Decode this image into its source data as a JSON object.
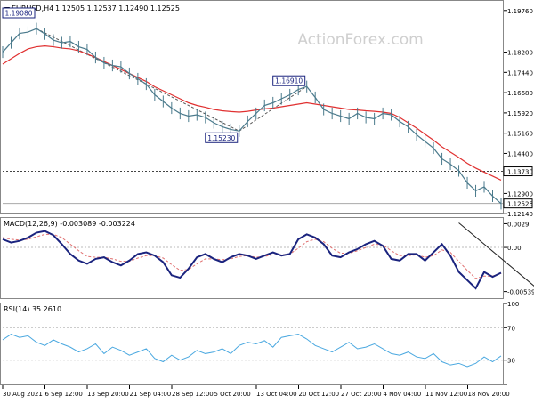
{
  "chart": {
    "header_symbol": "EURUSD,H4",
    "header_prices": "1.12505 1.12537 1.12490 1.12525",
    "watermark": "ActionForex.com",
    "colors": {
      "price": "#4a7a8c",
      "ma": "#e03030",
      "macd": "#1a237e",
      "signal": "#e07070",
      "rsi": "#4aa8e0",
      "label_border": "#1a237e",
      "label_text": "#1a237e",
      "grid": "#bbbbbb"
    }
  },
  "chart_data": [
    {
      "type": "line",
      "title": "EURUSD,H4",
      "ylim": [
        1.1218,
        1.2012
      ],
      "y_ticks": [
        "1.19760",
        "1.18200",
        "1.17440",
        "1.16680",
        "1.15920",
        "1.15160",
        "1.14400",
        "1.13730",
        "1.12900",
        "1.12525",
        "1.12140"
      ],
      "series": [
        {
          "values": [
            1.182,
            1.1855,
            1.189,
            1.1895,
            1.1908,
            1.1888,
            1.1865,
            1.1855,
            1.186,
            1.184,
            1.183,
            1.18,
            1.178,
            1.177,
            1.1765,
            1.174,
            1.172,
            1.17,
            1.166,
            1.1635,
            1.161,
            1.159,
            1.158,
            1.1585,
            1.1575,
            1.1555,
            1.154,
            1.153,
            1.1524,
            1.156,
            1.159,
            1.162,
            1.163,
            1.1645,
            1.166,
            1.168,
            1.1691,
            1.165,
            1.1605,
            1.159,
            1.158,
            1.157,
            1.159,
            1.1575,
            1.157,
            1.159,
            1.1585,
            1.156,
            1.154,
            1.151,
            1.1485,
            1.146,
            1.142,
            1.14,
            1.1375,
            1.133,
            1.13,
            1.1315,
            1.128,
            1.1252
          ]
        },
        {
          "name": "",
          "values": [
            1.1775,
            1.1795,
            1.1815,
            1.1832,
            1.184,
            1.1843,
            1.184,
            1.1835,
            1.1832,
            1.1825,
            1.1813,
            1.18,
            1.1785,
            1.177,
            1.1755,
            1.174,
            1.1725,
            1.171,
            1.169,
            1.1675,
            1.166,
            1.1645,
            1.163,
            1.162,
            1.1613,
            1.1605,
            1.16,
            1.1597,
            1.1595,
            1.1598,
            1.1603,
            1.1607,
            1.161,
            1.1615,
            1.162,
            1.1625,
            1.163,
            1.1625,
            1.162,
            1.1615,
            1.161,
            1.1605,
            1.1603,
            1.16,
            1.1598,
            1.1595,
            1.159,
            1.1575,
            1.1555,
            1.1535,
            1.1512,
            1.149,
            1.1465,
            1.1445,
            1.1425,
            1.1403,
            1.1385,
            1.137,
            1.1355,
            1.134
          ]
        }
      ],
      "annotations": [
        "1.19080",
        "1.15230",
        "1.16910",
        "1.13730",
        "1.12525"
      ],
      "reference_lines": [
        1.1373,
        1.12525
      ]
    },
    {
      "type": "line",
      "title": "MACD(12,26,9) -0.003089 -0.003224",
      "ylim": [
        -0.0062,
        0.0036
      ],
      "y_ticks": [
        "0.0029",
        "0.00",
        "-0.005396"
      ],
      "series": [
        {
          "values": [
            0.001,
            0.0006,
            0.0008,
            0.0012,
            0.0018,
            0.002,
            0.0015,
            0.0004,
            -0.0008,
            -0.0016,
            -0.002,
            -0.0014,
            -0.0012,
            -0.0018,
            -0.0022,
            -0.0016,
            -0.0008,
            -0.0006,
            -0.001,
            -0.0018,
            -0.0034,
            -0.0037,
            -0.0026,
            -0.0012,
            -0.0008,
            -0.0014,
            -0.0018,
            -0.0012,
            -0.0008,
            -0.001,
            -0.0014,
            -0.001,
            -0.0006,
            -0.001,
            -0.0008,
            0.001,
            0.0016,
            0.0012,
            0.0004,
            -0.001,
            -0.0012,
            -0.0006,
            -0.0002,
            0.0004,
            0.0008,
            0.0002,
            -0.0014,
            -0.0016,
            -0.0008,
            -0.0008,
            -0.0016,
            -0.0006,
            0.0004,
            -0.001,
            -0.003,
            -0.004,
            -0.005,
            -0.003,
            -0.0036,
            -0.0031
          ]
        },
        {
          "values": [
            0.0012,
            0.001,
            0.0009,
            0.001,
            0.0013,
            0.0016,
            0.0016,
            0.0012,
            0.0004,
            -0.0004,
            -0.0011,
            -0.0012,
            -0.0012,
            -0.0014,
            -0.0017,
            -0.0017,
            -0.0013,
            -0.001,
            -0.001,
            -0.0013,
            -0.0021,
            -0.0028,
            -0.0027,
            -0.002,
            -0.0014,
            -0.0014,
            -0.0015,
            -0.0014,
            -0.0011,
            -0.001,
            -0.0012,
            -0.0011,
            -0.0009,
            -0.0009,
            -0.0008,
            -0.0001,
            0.0007,
            0.001,
            0.0007,
            -0.0001,
            -0.0007,
            -0.0007,
            -0.0004,
            0.0,
            0.0004,
            0.0003,
            -0.0004,
            -0.001,
            -0.001,
            -0.0009,
            -0.0012,
            -0.001,
            -0.0003,
            -0.0006,
            -0.0017,
            -0.0028,
            -0.0038,
            -0.0035,
            -0.0035,
            -0.0032
          ]
        }
      ],
      "trendline": [
        [
          54,
          0.003
        ],
        [
          63,
          -0.0048
        ]
      ]
    },
    {
      "type": "line",
      "title": "RSI(14) 35.2610",
      "ylim": [
        0,
        100
      ],
      "y_ticks": [
        "100",
        "70",
        "30",
        "0"
      ],
      "series": [
        {
          "values": [
            55,
            62,
            58,
            60,
            52,
            48,
            55,
            50,
            46,
            40,
            44,
            50,
            38,
            46,
            42,
            36,
            40,
            44,
            32,
            28,
            36,
            30,
            34,
            42,
            38,
            40,
            44,
            38,
            48,
            52,
            50,
            54,
            46,
            58,
            60,
            62,
            56,
            48,
            44,
            40,
            46,
            52,
            44,
            46,
            50,
            44,
            38,
            36,
            40,
            34,
            32,
            38,
            28,
            24,
            26,
            22,
            26,
            34,
            28,
            35.261
          ]
        }
      ]
    }
  ],
  "x_labels": [
    "30 Aug 2021",
    "6 Sep 12:00",
    "13 Sep 20:00",
    "21 Sep 04:00",
    "28 Sep 12:00",
    "5 Oct 20:00",
    "13 Oct 04:00",
    "20 Oct 12:00",
    "27 Oct 20:00",
    "4 Nov 04:00",
    "11 Nov 12:00",
    "18 Nov 20:00"
  ]
}
